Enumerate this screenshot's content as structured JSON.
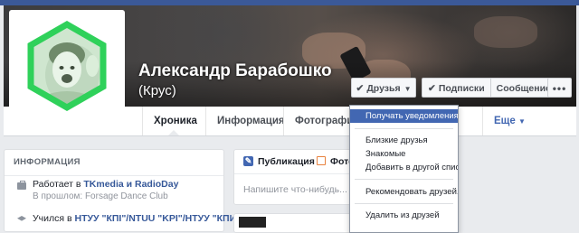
{
  "profile": {
    "name": "Александр Барабошко",
    "nickname": "(Крус)"
  },
  "actions": {
    "friends_label": "Друзья",
    "follow_label": "Подписки",
    "message_label": "Сообщение",
    "more_label": "•••"
  },
  "nav": {
    "tabs": [
      {
        "label": "Хроника",
        "active": true
      },
      {
        "label": "Информация"
      },
      {
        "label": "Фотографии"
      },
      {
        "label": "Еще"
      }
    ]
  },
  "dropdown": {
    "items": [
      {
        "label": "Получать уведомления",
        "highlighted": true
      },
      {
        "label": "Близкие друзья"
      },
      {
        "label": "Знакомые"
      },
      {
        "label": "Добавить в другой список..."
      },
      {
        "label": "Рекомендовать друзей..."
      },
      {
        "label": "Удалить из друзей"
      }
    ]
  },
  "intro": {
    "header": "ИНФОРМАЦИЯ",
    "work_prefix": "Работает в ",
    "work_company": "TKmedia и RadioDay",
    "work_past": "В прошлом: Forsage Dance Club",
    "study_prefix": "Учился в ",
    "study_school": "НТУУ \"КПІ\"/NTUU \"KPI\"/НТУУ \"КПИ\""
  },
  "composer": {
    "tab_post": "Публикация",
    "tab_photo": "Фото",
    "placeholder": "Напишите что-нибудь..."
  },
  "colors": {
    "brand": "#3b5998",
    "avatar_hexagon": "#2fd15a",
    "highlight": "#4267b2"
  }
}
